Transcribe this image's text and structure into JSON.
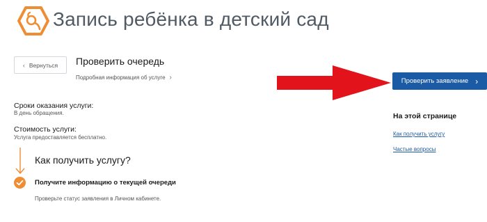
{
  "header": {
    "title": "Запись ребёнка в детский сад",
    "logo_icon": "pacifier-icon"
  },
  "toolbar": {
    "back_label": "Вернуться",
    "page_title": "Проверить очередь",
    "detail_link": "Подробная информация об услуге",
    "check_button": "Проверить заявление"
  },
  "info": {
    "terms_label": "Сроки оказания услуги:",
    "terms_value": "В день обращения.",
    "cost_label": "Стоимость услуги:",
    "cost_value": "Услуга предоставляется бесплатно."
  },
  "how_to": {
    "title": "Как получить услугу?",
    "step_title": "Получите информацию о текущей очереди",
    "step_desc": "Проверьте статус заявления в Личном кабинете."
  },
  "sidebar": {
    "heading": "На этой странице",
    "links": [
      "Как получить услугу",
      "Частые вопросы"
    ]
  },
  "colors": {
    "accent_orange": "#ef8d34",
    "primary_blue": "#1b5ba6",
    "annotation_red": "#e3131b"
  }
}
